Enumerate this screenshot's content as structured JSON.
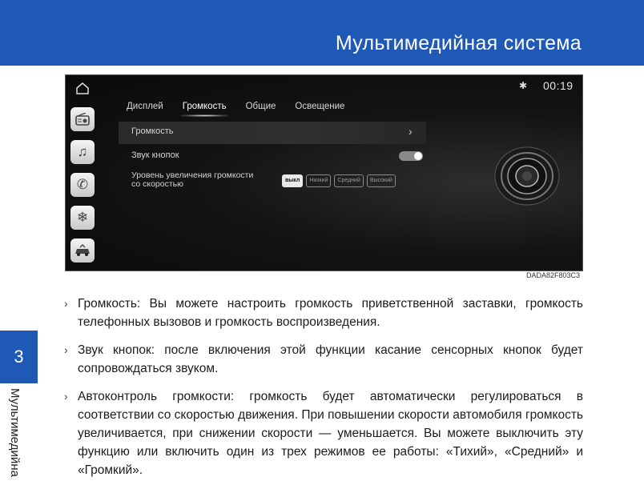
{
  "header": {
    "title": "Мультимедийная система"
  },
  "chapter": {
    "number": "3",
    "side_label": "Мультимедийна"
  },
  "screen": {
    "clock": "00:19",
    "tabs": [
      {
        "label": "Дисплей",
        "active": false
      },
      {
        "label": "Громкость",
        "active": true
      },
      {
        "label": "Общие",
        "active": false
      },
      {
        "label": "Освещение",
        "active": false
      }
    ],
    "settings": {
      "volume_label": "Громкость",
      "key_sound_label": "Звук кнопок",
      "key_sound_on": true,
      "speed_volume_label": "Уровень увеличения громкости со скоростью",
      "options": [
        "выкл",
        "Низкий",
        "Средний",
        "Высокий"
      ],
      "selected_option": "выкл"
    },
    "side_apps": [
      "radio-icon",
      "music-icon",
      "phone-icon",
      "climate-icon",
      "vehicle-icon"
    ]
  },
  "image_code": "DADA82F803C3",
  "bullets": [
    "Громкость: Вы можете настроить громкость приветственной заставки, громкость телефонных вызовов и громкость воспроизведения.",
    "Звук кнопок: после включения этой функции касание сенсорных кнопок будет сопровождаться звуком.",
    "Автоконтроль громкости: громкость будет автоматически регулироваться в соответствии со скоростью движения. При повышении скорости автомобиля громкость увеличивается, при снижении скорости — уменьшается. Вы можете выключить эту функцию или включить один из трех режимов ее работы: «Тихий», «Средний» и «Громкий»."
  ],
  "colors": {
    "header_blue": "#1f58b5"
  }
}
